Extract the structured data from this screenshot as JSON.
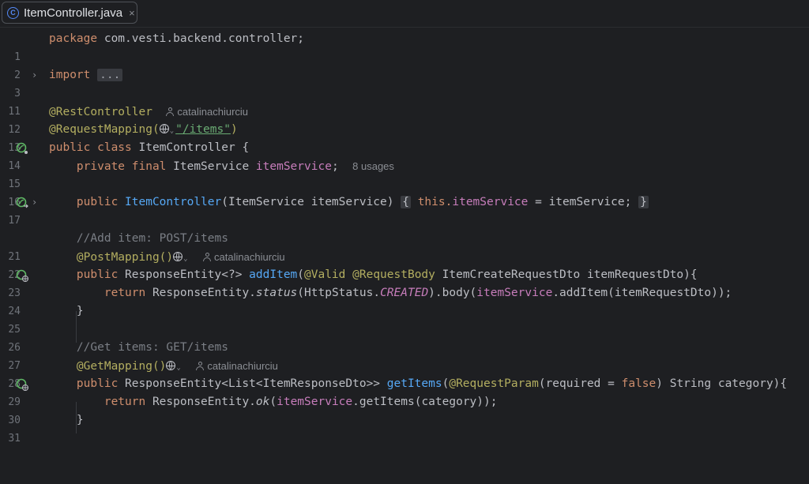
{
  "tab": {
    "title": "ItemController.java",
    "icon": "java-class-icon",
    "close": "×"
  },
  "lines": {
    "l1": {
      "no": "1",
      "pre": "package ",
      "text": "com.vesti.backend.controller;"
    },
    "l2": {
      "no": "2"
    },
    "l3": {
      "no": "3",
      "kw": "import",
      "folded": "..."
    },
    "l11": {
      "no": "11"
    },
    "l12": {
      "no": "12",
      "ann": "@RestController",
      "author": "catalinachiurciu"
    },
    "l13": {
      "no": "13",
      "ann": "@RequestMapping(",
      "url": "\"/items\"",
      "close": ")"
    },
    "l14": {
      "no": "14",
      "kw": "public class ",
      "name": "ItemController {"
    },
    "l15": {
      "no": "15",
      "kw": "private final ",
      "type": "ItemService ",
      "field": "itemService",
      "semi": ";",
      "usages": "8 usages"
    },
    "l16": {
      "no": "16"
    },
    "l17": {
      "no": "17",
      "kw": "public ",
      "fn": "ItemController",
      "params": "(ItemService itemService) ",
      "ob": "{",
      "this": " this.",
      "field": "itemService",
      "rest": " = itemService; ",
      "cb": "}"
    },
    "l21": {
      "no": "21",
      "comment": "//Add item: POST/items"
    },
    "l22": {
      "no": "22",
      "ann": "@PostMapping()",
      "author": "catalinachiurciu"
    },
    "l23": {
      "no": "23",
      "kw": "public ",
      "type": "ResponseEntity<?> ",
      "fn": "addItem",
      "p1": "(",
      "ann1": "@Valid ",
      "ann2": "@RequestBody ",
      "rest": "ItemCreateRequestDto itemRequestDto){"
    },
    "l24": {
      "no": "24",
      "kw": "return ",
      "a": "ResponseEntity.",
      "m": "status",
      "b": "(HttpStatus.",
      "c": "CREATED",
      "d": ").body(",
      "f": "itemService",
      "e": ".addItem(itemRequestDto));"
    },
    "l25": {
      "no": "25",
      "text": "}"
    },
    "l26": {
      "no": "26"
    },
    "l27": {
      "no": "27",
      "comment": "//Get items: GET/items"
    },
    "l28": {
      "no": "28",
      "ann": "@GetMapping()",
      "author": "catalinachiurciu"
    },
    "l29": {
      "no": "29",
      "kw": "public ",
      "type": "ResponseEntity<List<ItemResponseDto>> ",
      "fn": "getItems",
      "p1": "(",
      "ann1": "@RequestParam",
      "p2": "(required = ",
      "kw2": "false",
      "rest": ") String category){"
    },
    "l30": {
      "no": "30",
      "kw": "return ",
      "a": "ResponseEntity.",
      "m": "ok",
      "b": "(",
      "f": "itemService",
      "e": ".getItems(category));"
    },
    "l31": {
      "no": "31",
      "text": "}"
    }
  }
}
